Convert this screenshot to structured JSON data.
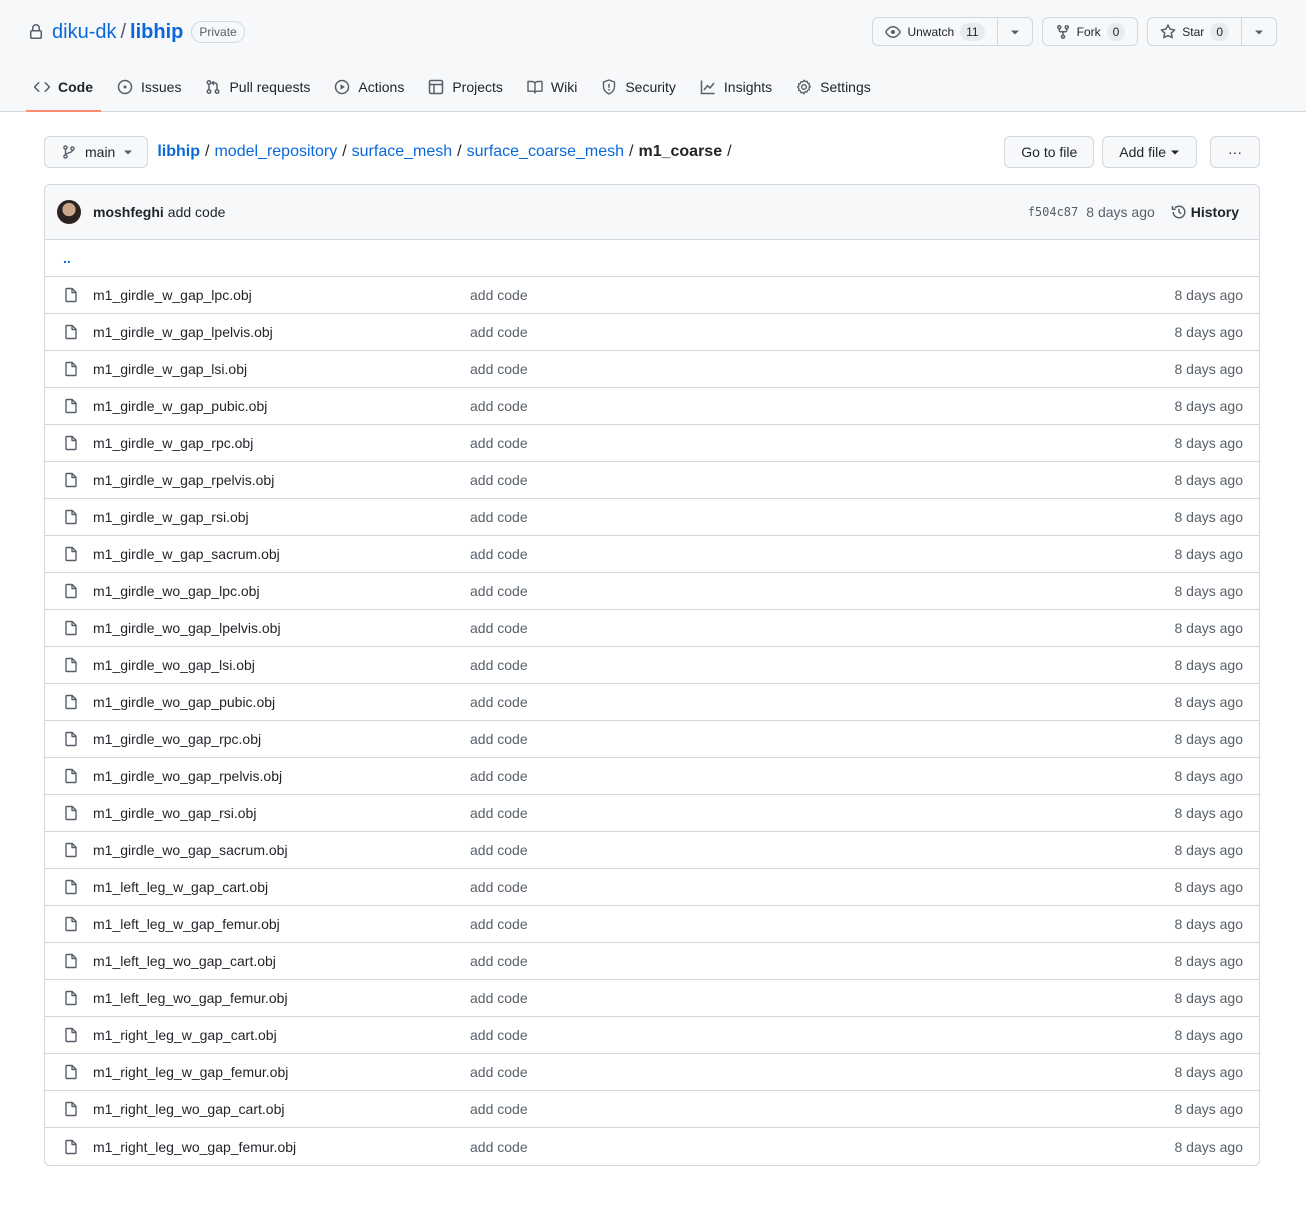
{
  "repo": {
    "owner": "diku-dk",
    "name": "libhip",
    "visibility": "Private",
    "watch_label": "Unwatch",
    "watch_count": "11",
    "fork_label": "Fork",
    "fork_count": "0",
    "star_label": "Star",
    "star_count": "0"
  },
  "nav": {
    "tabs": [
      {
        "label": "Code",
        "icon": "code-icon"
      },
      {
        "label": "Issues",
        "icon": "issue-icon"
      },
      {
        "label": "Pull requests",
        "icon": "pull-request-icon"
      },
      {
        "label": "Actions",
        "icon": "play-icon"
      },
      {
        "label": "Projects",
        "icon": "table-icon"
      },
      {
        "label": "Wiki",
        "icon": "book-icon"
      },
      {
        "label": "Security",
        "icon": "shield-icon"
      },
      {
        "label": "Insights",
        "icon": "graph-icon"
      },
      {
        "label": "Settings",
        "icon": "gear-icon"
      }
    ]
  },
  "file_nav": {
    "branch": "main",
    "breadcrumb": [
      "libhip",
      "model_repository",
      "surface_mesh",
      "surface_coarse_mesh"
    ],
    "current": "m1_coarse",
    "trailing_sep": "/",
    "sep": "/",
    "go_to_file": "Go to file",
    "add_file": "Add file",
    "more": "···"
  },
  "commit": {
    "author": "moshfeghi",
    "message": "add code",
    "sha": "f504c87",
    "age": "8 days ago",
    "history": "History"
  },
  "parent_link": "..",
  "files": [
    {
      "name": "m1_girdle_w_gap_lpc.obj",
      "msg": "add code",
      "age": "8 days ago"
    },
    {
      "name": "m1_girdle_w_gap_lpelvis.obj",
      "msg": "add code",
      "age": "8 days ago"
    },
    {
      "name": "m1_girdle_w_gap_lsi.obj",
      "msg": "add code",
      "age": "8 days ago"
    },
    {
      "name": "m1_girdle_w_gap_pubic.obj",
      "msg": "add code",
      "age": "8 days ago"
    },
    {
      "name": "m1_girdle_w_gap_rpc.obj",
      "msg": "add code",
      "age": "8 days ago"
    },
    {
      "name": "m1_girdle_w_gap_rpelvis.obj",
      "msg": "add code",
      "age": "8 days ago"
    },
    {
      "name": "m1_girdle_w_gap_rsi.obj",
      "msg": "add code",
      "age": "8 days ago"
    },
    {
      "name": "m1_girdle_w_gap_sacrum.obj",
      "msg": "add code",
      "age": "8 days ago"
    },
    {
      "name": "m1_girdle_wo_gap_lpc.obj",
      "msg": "add code",
      "age": "8 days ago"
    },
    {
      "name": "m1_girdle_wo_gap_lpelvis.obj",
      "msg": "add code",
      "age": "8 days ago"
    },
    {
      "name": "m1_girdle_wo_gap_lsi.obj",
      "msg": "add code",
      "age": "8 days ago"
    },
    {
      "name": "m1_girdle_wo_gap_pubic.obj",
      "msg": "add code",
      "age": "8 days ago"
    },
    {
      "name": "m1_girdle_wo_gap_rpc.obj",
      "msg": "add code",
      "age": "8 days ago"
    },
    {
      "name": "m1_girdle_wo_gap_rpelvis.obj",
      "msg": "add code",
      "age": "8 days ago"
    },
    {
      "name": "m1_girdle_wo_gap_rsi.obj",
      "msg": "add code",
      "age": "8 days ago"
    },
    {
      "name": "m1_girdle_wo_gap_sacrum.obj",
      "msg": "add code",
      "age": "8 days ago"
    },
    {
      "name": "m1_left_leg_w_gap_cart.obj",
      "msg": "add code",
      "age": "8 days ago"
    },
    {
      "name": "m1_left_leg_w_gap_femur.obj",
      "msg": "add code",
      "age": "8 days ago"
    },
    {
      "name": "m1_left_leg_wo_gap_cart.obj",
      "msg": "add code",
      "age": "8 days ago"
    },
    {
      "name": "m1_left_leg_wo_gap_femur.obj",
      "msg": "add code",
      "age": "8 days ago"
    },
    {
      "name": "m1_right_leg_w_gap_cart.obj",
      "msg": "add code",
      "age": "8 days ago"
    },
    {
      "name": "m1_right_leg_w_gap_femur.obj",
      "msg": "add code",
      "age": "8 days ago"
    },
    {
      "name": "m1_right_leg_wo_gap_cart.obj",
      "msg": "add code",
      "age": "8 days ago"
    },
    {
      "name": "m1_right_leg_wo_gap_femur.obj",
      "msg": "add code",
      "age": "8 days ago"
    }
  ]
}
